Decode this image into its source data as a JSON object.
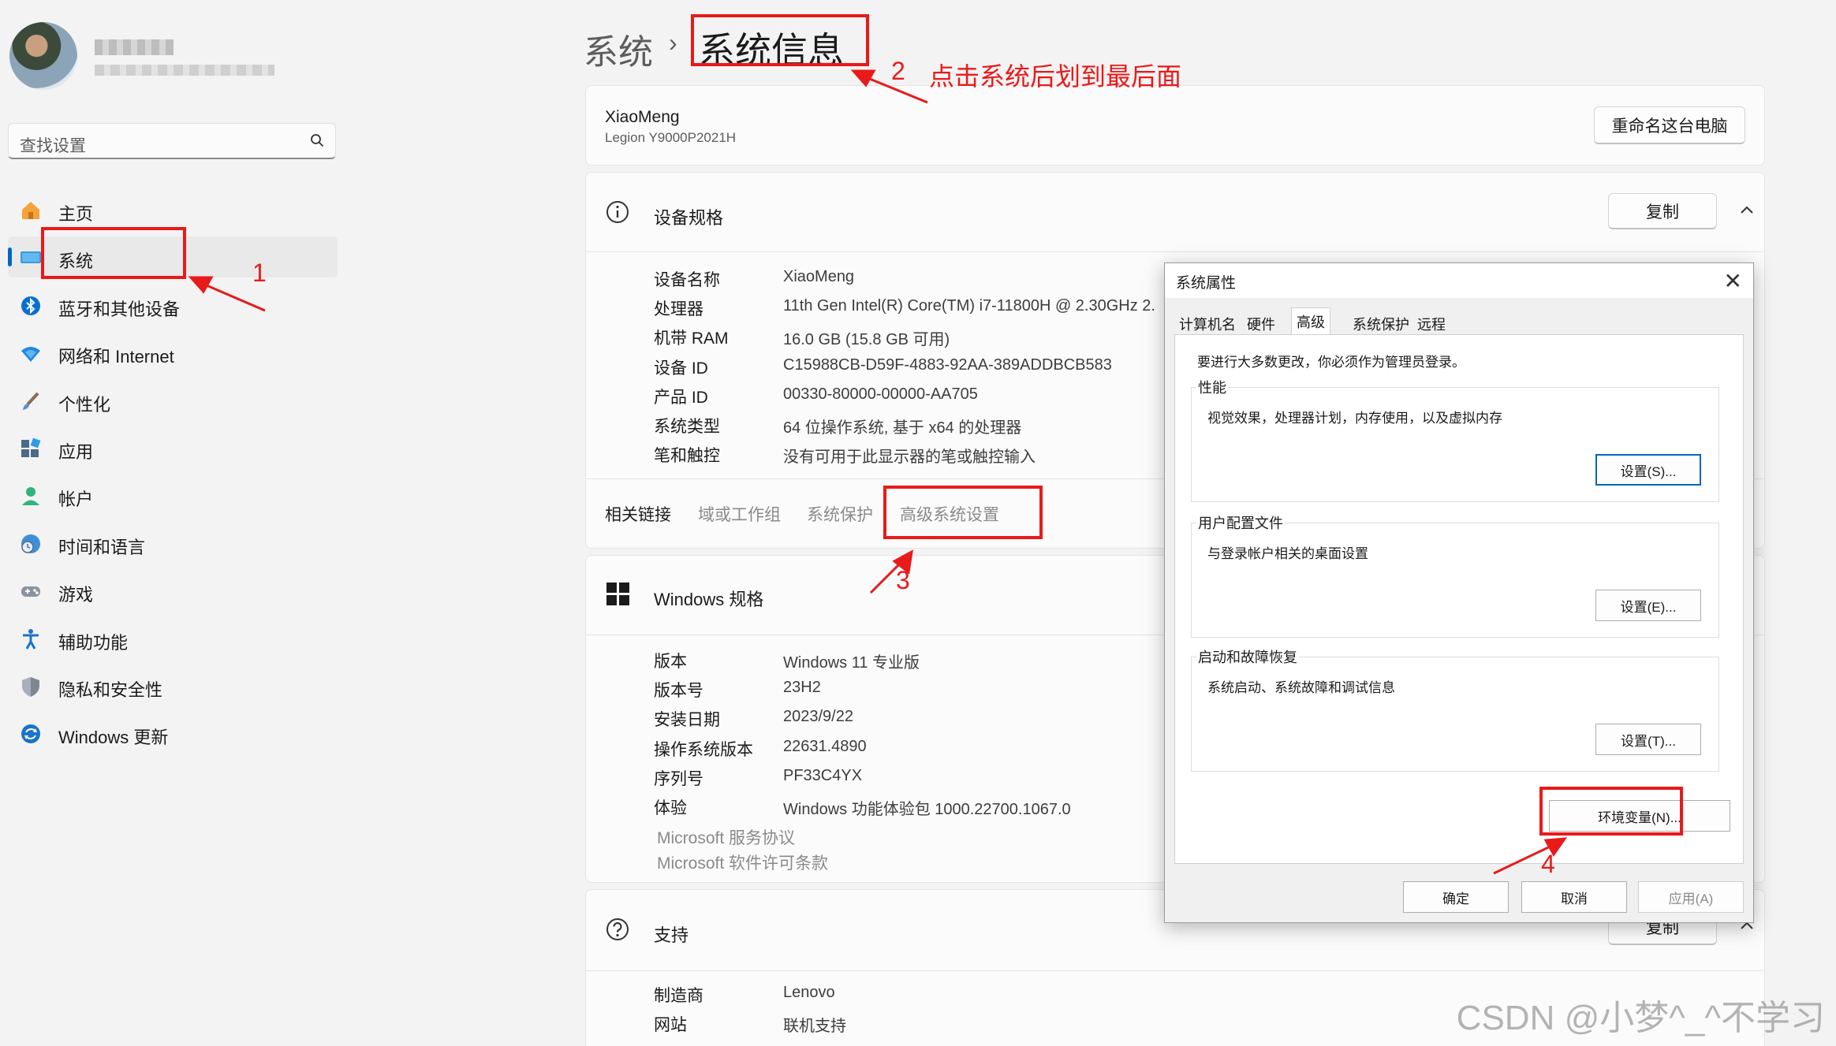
{
  "sidebar": {
    "search_placeholder": "查找设置",
    "items": [
      {
        "label": "主页",
        "icon": "home-icon"
      },
      {
        "label": "系统",
        "icon": "system-icon"
      },
      {
        "label": "蓝牙和其他设备",
        "icon": "bluetooth-icon"
      },
      {
        "label": "网络和 Internet",
        "icon": "network-icon"
      },
      {
        "label": "个性化",
        "icon": "brush-icon"
      },
      {
        "label": "应用",
        "icon": "apps-icon"
      },
      {
        "label": "帐户",
        "icon": "account-icon"
      },
      {
        "label": "时间和语言",
        "icon": "globe-clock-icon"
      },
      {
        "label": "游戏",
        "icon": "gamepad-icon"
      },
      {
        "label": "辅助功能",
        "icon": "accessibility-icon"
      },
      {
        "label": "隐私和安全性",
        "icon": "shield-icon"
      },
      {
        "label": "Windows 更新",
        "icon": "update-icon"
      }
    ],
    "active_index": 1
  },
  "breadcrumb": {
    "parent": "系统",
    "separator": "›",
    "current": "系统信息"
  },
  "pc_card": {
    "name": "XiaoMeng",
    "model": "Legion Y9000P2021H",
    "rename_label": "重命名这台电脑"
  },
  "device_specs": {
    "title": "设备规格",
    "copy_label": "复制",
    "rows": [
      {
        "label": "设备名称",
        "value": "XiaoMeng"
      },
      {
        "label": "处理器",
        "value": "11th Gen Intel(R) Core(TM) i7-11800H @ 2.30GHz   2."
      },
      {
        "label": "机带 RAM",
        "value": "16.0 GB (15.8 GB 可用)"
      },
      {
        "label": "设备 ID",
        "value": "C15988CB-D59F-4883-92AA-389ADDBCB583"
      },
      {
        "label": "产品 ID",
        "value": "00330-80000-00000-AA705"
      },
      {
        "label": "系统类型",
        "value": "64 位操作系统, 基于 x64 的处理器"
      },
      {
        "label": "笔和触控",
        "value": "没有可用于此显示器的笔或触控输入"
      }
    ]
  },
  "related_links": {
    "label": "相关链接",
    "links": [
      "域或工作组",
      "系统保护",
      "高级系统设置"
    ]
  },
  "windows_specs": {
    "title": "Windows 规格",
    "rows": [
      {
        "label": "版本",
        "value": "Windows 11 专业版"
      },
      {
        "label": "版本号",
        "value": "23H2"
      },
      {
        "label": "安装日期",
        "value": "2023/9/22"
      },
      {
        "label": "操作系统版本",
        "value": "22631.4890"
      },
      {
        "label": "序列号",
        "value": "PF33C4YX"
      },
      {
        "label": "体验",
        "value": "Windows 功能体验包 1000.22700.1067.0"
      }
    ],
    "links": [
      "Microsoft 服务协议",
      "Microsoft 软件许可条款"
    ]
  },
  "support": {
    "title": "支持",
    "copy_label": "复制",
    "rows": [
      {
        "label": "制造商",
        "value": "Lenovo"
      },
      {
        "label": "网站",
        "value": "联机支持"
      }
    ]
  },
  "dialog": {
    "title": "系统属性",
    "close": "✕",
    "tabs": [
      "计算机名",
      "硬件",
      "高级",
      "系统保护",
      "远程"
    ],
    "active_tab": 2,
    "admin_note": "要进行大多数更改，你必须作为管理员登录。",
    "groups": [
      {
        "title": "性能",
        "desc": "视觉效果，处理器计划，内存使用，以及虚拟内存",
        "button": "设置(S)..."
      },
      {
        "title": "用户配置文件",
        "desc": "与登录帐户相关的桌面设置",
        "button": "设置(E)..."
      },
      {
        "title": "启动和故障恢复",
        "desc": "系统启动、系统故障和调试信息",
        "button": "设置(T)..."
      }
    ],
    "env_button": "环境变量(N)...",
    "ok": "确定",
    "cancel": "取消",
    "apply": "应用(A)"
  },
  "annotations": {
    "step1": "1",
    "step2": "2",
    "step2_text": "点击系统后划到最后面",
    "step3": "3",
    "step4": "4",
    "color": "#e81a1a"
  },
  "watermark": "CSDN @小梦^_^不学习"
}
